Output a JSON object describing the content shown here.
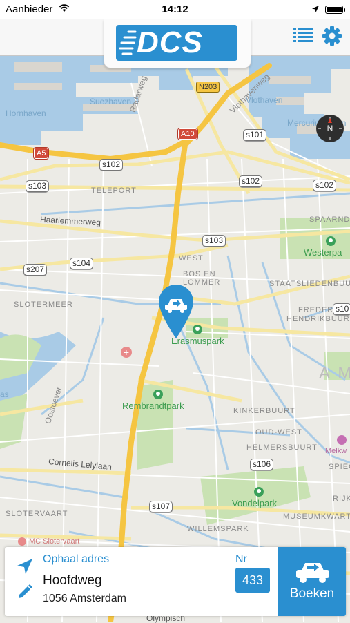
{
  "status_bar": {
    "carrier": "Aanbieder",
    "time": "14:12"
  },
  "header": {
    "logo_text": "DCS",
    "menu_icon": "list-icon",
    "settings_icon": "gear-icon"
  },
  "map": {
    "water_labels": [
      "Hornhaven",
      "Suezhaven",
      "Vlothaven",
      "Mercuriushaven",
      "as"
    ],
    "district_labels": [
      "TELEPORT",
      "WEST",
      "BOS EN",
      "LOMMER",
      "SLOTERMEER",
      "STAATSLIEDENBUURT",
      "FREDERIK",
      "HENDRIKBUURT",
      "KINKERBUURT",
      "OUD-WEST",
      "HELMERSBUURT",
      "WILLEMSPARK",
      "MUSEUMKWART",
      "SLOTERVAART",
      "SPAARNDA",
      "SPIEG",
      "RIJKS"
    ],
    "park_labels": [
      "Westerpa",
      "Erasmuspark",
      "Rembrandtpark",
      "Vondelpark"
    ],
    "road_labels": [
      "Haarlemmerweg",
      "Radarweg",
      "Vlothavenweg",
      "Oostoever",
      "Cornelis Lelylaan",
      "Olympisch"
    ],
    "road_shields": [
      "s101",
      "s102",
      "s102",
      "s102",
      "s103",
      "s103",
      "s104",
      "s207",
      "s106",
      "s107",
      "s10"
    ],
    "highway_shields": [
      "A5",
      "A10"
    ],
    "national_shields": [
      "N203"
    ],
    "big_label": "A M",
    "poi_labels": [
      "MC Slotervaart",
      "Melkw"
    ],
    "compass_letter": "N"
  },
  "booking_card": {
    "pickup_label": "Ophaal adres",
    "street": "Hoofdweg",
    "city": "1056 Amsterdam",
    "number_label": "Nr",
    "number_value": "433",
    "book_button_label": "Boeken"
  },
  "colors": {
    "accent": "#2a8fd0",
    "park": "#3aa05a",
    "highway": "#f5c542"
  }
}
